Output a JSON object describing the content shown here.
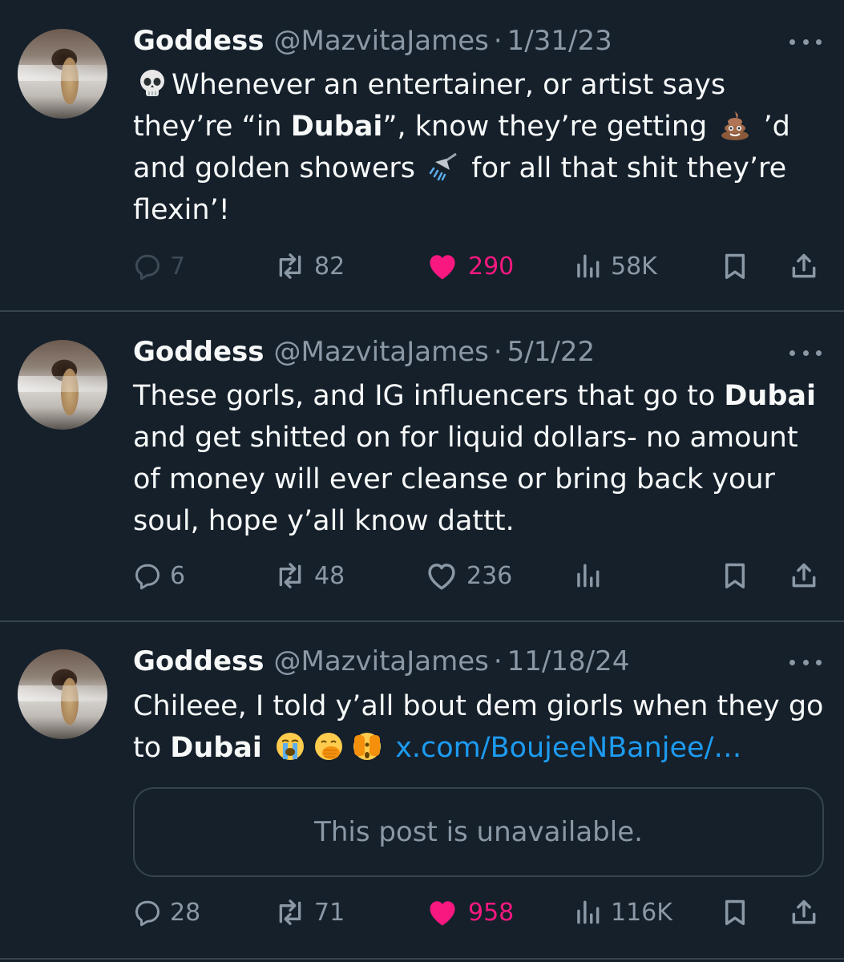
{
  "tweets": [
    {
      "author_name": "Goddess",
      "handle": "@MazvitaJames",
      "separator": "·",
      "date": "1/31/23",
      "text": {
        "p1": "Whenever an entertainer, or artist says they’re “in ",
        "bold": "Dubai",
        "p2": "”, know they’re getting ",
        "p3": " ’d and golden showers ",
        "p4": " for all that shit they’re flexin’!"
      },
      "reply_count": "7",
      "retweet_count": "82",
      "like_count": "290",
      "view_count": "58K",
      "liked": true
    },
    {
      "author_name": "Goddess",
      "handle": "@MazvitaJames",
      "separator": "·",
      "date": "5/1/22",
      "text": {
        "p1": "These gorls, and IG influencers that go to ",
        "bold": "Dubai",
        "p2": " and get shitted on for liquid dollars- no amount of money will ever cleanse or bring back your soul, hope y’all know dattt."
      },
      "reply_count": "6",
      "retweet_count": "48",
      "like_count": "236",
      "view_count": "",
      "liked": false
    },
    {
      "author_name": "Goddess",
      "handle": "@MazvitaJames",
      "separator": "·",
      "date": "11/18/24",
      "text": {
        "p1": "Chileee, I told y’all bout dem giorls when they go to ",
        "bold": "Dubai",
        "link": "x.com/BoujeeNBanjee/…"
      },
      "card_text": "This post is unavailable.",
      "reply_count": "28",
      "retweet_count": "71",
      "like_count": "958",
      "view_count": "116K",
      "liked": true
    }
  ],
  "icons": {
    "skull": "skull-emoji",
    "poop": "pile-of-poo-emoji",
    "shower": "shower-emoji",
    "crying": "loudly-crying-face-emoji",
    "hand_over_mouth": "face-with-hand-over-mouth-emoji",
    "peeking": "face-with-peeking-eye-emoji"
  },
  "colors": {
    "background": "#15202b",
    "text": "#f7f9f9",
    "muted": "#8b98a5",
    "like": "#f91880",
    "link": "#1d9bf0",
    "divider": "#38444d"
  }
}
